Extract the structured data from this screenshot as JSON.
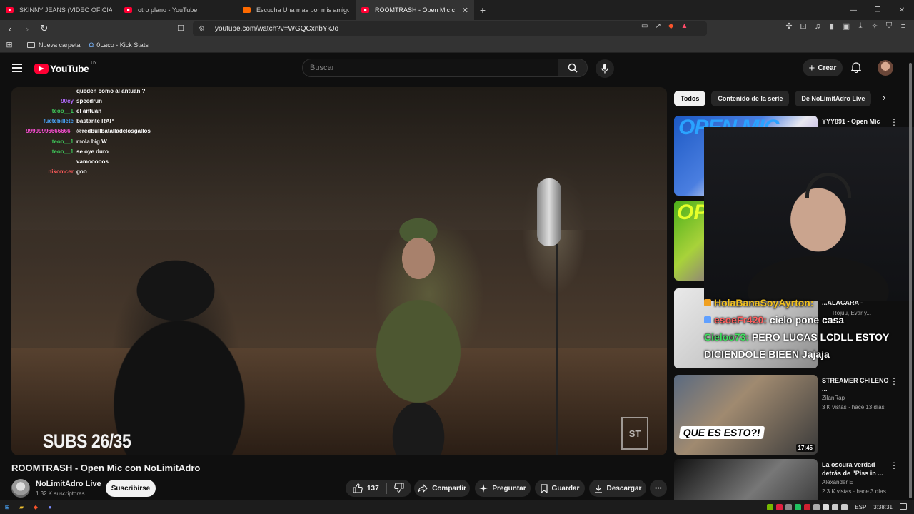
{
  "browser": {
    "tabs": [
      {
        "title": "SKINNY JEANS (VIDEO OFICIAL) - Yo",
        "favicon": "youtube-icon",
        "active": false
      },
      {
        "title": "otro plano - YouTube",
        "favicon": "youtube-icon",
        "active": false
      },
      {
        "title": "Escucha Una mas por mis amigos. Pr",
        "favicon": "soundcloud-icon",
        "active": false
      },
      {
        "title": "ROOMTRASH - Open Mic con N",
        "favicon": "youtube-icon",
        "active": true
      }
    ],
    "url": "youtube.com/watch?v=WGQCxnbYkJo",
    "bookmarks": [
      {
        "label": "Nueva carpeta",
        "icon": "folder-icon"
      },
      {
        "label": "0Laco - Kick Stats",
        "icon": "kick-icon"
      }
    ]
  },
  "youtube": {
    "logo_text": "YouTube",
    "country_code": "UY",
    "search_placeholder": "Buscar",
    "create_label": "Crear"
  },
  "video": {
    "title": "ROOMTRASH - Open Mic con NoLimitAdro",
    "overlay_text": "SUBS 26/35",
    "chat": [
      {
        "user": "",
        "message": "queden como al antuan ?",
        "color": "#ffffff"
      },
      {
        "user": "90cy",
        "message": "speedrun",
        "color": "#b36bff"
      },
      {
        "user": "teoo__1",
        "message": "el antuan",
        "color": "#3ec85a"
      },
      {
        "user": "fuetebillete",
        "message": "bastante RAP",
        "color": "#4aa8ff"
      },
      {
        "user": "99999996666666_",
        "message": "@redbullbatalladelosgallos",
        "color": "#ff4fd8"
      },
      {
        "user": "teoo__1",
        "message": "mola big W",
        "color": "#3ec85a"
      },
      {
        "user": "teoo__1",
        "message": "se oye duro",
        "color": "#3ec85a"
      },
      {
        "user": "",
        "message": "vamooooos",
        "color": "#4a40ff"
      },
      {
        "user": "nikomcer",
        "message": "goo",
        "color": "#ff5a5a"
      }
    ]
  },
  "channel": {
    "name": "NoLimitAdro Live",
    "subscribers": "1.32 K suscriptores",
    "subscribe_label": "Suscribirse"
  },
  "actions": {
    "likes": "137",
    "share": "Compartir",
    "ask": "Preguntar",
    "save": "Guardar",
    "download": "Descargar"
  },
  "chips": [
    "Todos",
    "Contenido de la serie",
    "De NoLimitAdro Live"
  ],
  "recommendations": [
    {
      "title": "YYY891 - Open Mic",
      "channel": "",
      "meta": "",
      "duration": "",
      "thumb_text": "OPEN MIC"
    },
    {
      "title": "",
      "channel": "",
      "meta": "",
      "duration": "",
      "thumb_text": "OP"
    },
    {
      "title": "...ALACARA -",
      "channel": "Rojuu, Evar y...",
      "meta": "",
      "duration": "",
      "thumb_text": ""
    },
    {
      "title": "STREAMER CHILENO ...",
      "channel": "ZilanRap",
      "meta": "3 K vistas · hace 13 días",
      "duration": "17:45",
      "thumb_text": "QUE ES ESTO?!"
    },
    {
      "title": "La oscura verdad detrás de \"Piss in ...",
      "channel": "Alexander E",
      "meta": "2.3 K vistas · hace 3 días",
      "duration": "",
      "thumb_text": ""
    }
  ],
  "stream_overlay_chat": [
    {
      "user": "HolaBanaSoyAyrton:",
      "message": "",
      "user_color": "#f0c020"
    },
    {
      "user": "esoeFr420:",
      "message": "cielo pone casa",
      "user_color": "#ff6060"
    },
    {
      "user": "Cieloo73:",
      "message": "PERO LUCAS LCDLL ESTOY",
      "user_color": "#40e060"
    },
    {
      "user": "",
      "message": "DICIENDOLE BIEEN Jajaja",
      "user_color": "#ffffff"
    }
  ],
  "taskbar": {
    "language": "ESP",
    "time": "3:38:31"
  }
}
